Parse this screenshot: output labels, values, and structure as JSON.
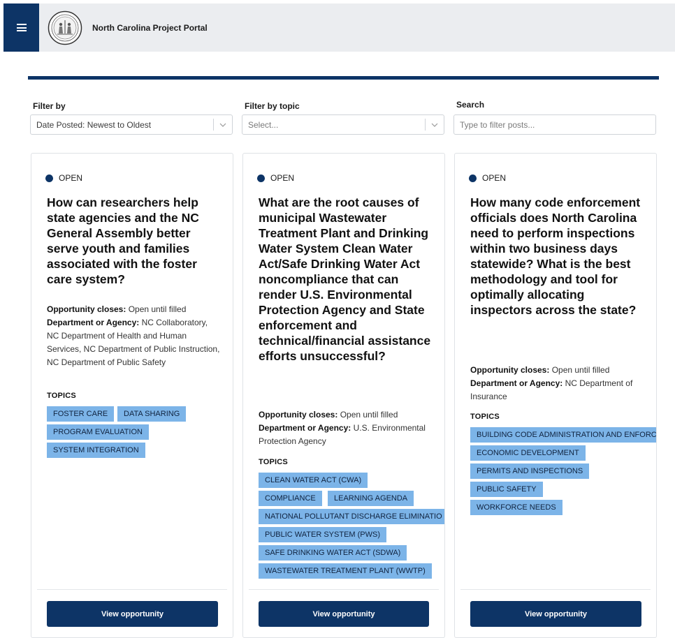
{
  "header": {
    "portal_title": "North Carolina Project Portal",
    "menu_icon": "hamburger-menu-icon",
    "seal_icon": "nc-state-seal-icon",
    "brand_color": "#0d3466"
  },
  "filters": {
    "filter_by_label": "Filter by",
    "filter_by_value": "Date Posted: Newest to Oldest",
    "topic_label": "Filter by topic",
    "topic_placeholder": "Select...",
    "search_label": "Search",
    "search_placeholder": "Type to filter posts..."
  },
  "cards": [
    {
      "status": "OPEN",
      "title": "How can researchers help state agencies and the NC General Assembly better serve youth and families associated with the foster care system?",
      "closes_label": "Opportunity closes:",
      "closes_value": "Open until filled",
      "dept_label": "Department or Agency:",
      "dept_value": "NC Collaboratory, NC Department of Health and Human Services, NC Department of Public Instruction, NC Department of Public Safety",
      "topics_label": "TOPICS",
      "topics": [
        "FOSTER CARE",
        "DATA SHARING",
        "PROGRAM EVALUATION",
        "SYSTEM INTEGRATION"
      ],
      "button_label": "View opportunity"
    },
    {
      "status": "OPEN",
      "title": "What are the root causes of municipal Wastewater Treatment Plant and Drinking Water System Clean Water Act/Safe Drinking Water Act noncompliance that can render U.S. Environmental Protection Agency and State enforcement and technical/financial assistance efforts unsuccessful?",
      "closes_label": "Opportunity closes:",
      "closes_value": "Open until filled",
      "dept_label": "Department or Agency:",
      "dept_value": "U.S. Environmental Protection Agency",
      "topics_label": "TOPICS",
      "topics": [
        "CLEAN WATER ACT (CWA)",
        "COMPLIANCE",
        "LEARNING AGENDA",
        "NATIONAL POLLUTANT DISCHARGE ELIMINATIO",
        "PUBLIC WATER SYSTEM (PWS)",
        "SAFE DRINKING WATER ACT (SDWA)",
        "WASTEWATER TREATMENT PLANT (WWTP)"
      ],
      "button_label": "View opportunity"
    },
    {
      "status": "OPEN",
      "title": "How many code enforcement officials does North Carolina need to perform inspections within two business days statewide? What is the best methodology and tool for optimally allocating inspectors across the state?",
      "closes_label": "Opportunity closes:",
      "closes_value": "Open until filled",
      "dept_label": "Department or Agency:",
      "dept_value": "NC Department of Insurance",
      "topics_label": "TOPICS",
      "topics": [
        "BUILDING CODE ADMINISTRATION AND ENFORC",
        "ECONOMIC DEVELOPMENT",
        "PERMITS AND INSPECTIONS",
        "PUBLIC SAFETY",
        "WORKFORCE NEEDS"
      ],
      "button_label": "View opportunity"
    }
  ]
}
